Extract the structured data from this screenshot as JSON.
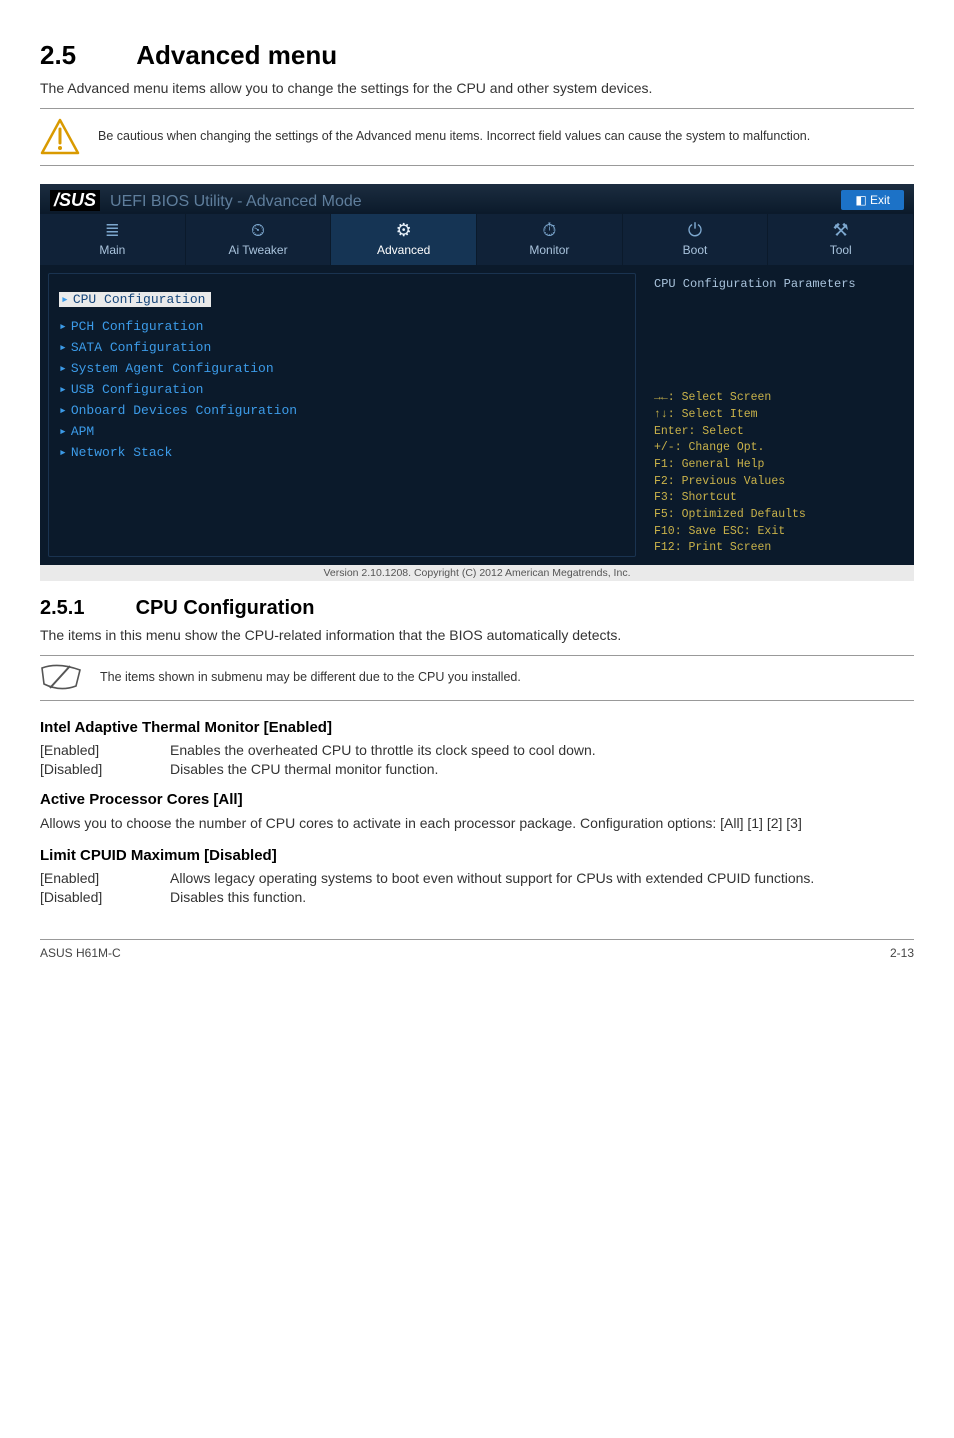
{
  "heading": {
    "num": "2.5",
    "title": "Advanced menu"
  },
  "intro": "The Advanced menu items allow you to change the settings for the CPU and other system devices.",
  "caution": "Be cautious when changing the settings of the Advanced menu items. Incorrect field values can cause the system to malfunction.",
  "bios": {
    "brand": "/SUS",
    "title_sub": "UEFI BIOS Utility - Advanced Mode",
    "exit_label": "Exit",
    "tabs": [
      {
        "icon": "≣",
        "label": "Main"
      },
      {
        "icon": "⏲",
        "label": "Ai Tweaker"
      },
      {
        "icon": "⚙",
        "label": "Advanced"
      },
      {
        "icon": "⏱",
        "label": "Monitor"
      },
      {
        "icon": "⏻",
        "label": "Boot"
      },
      {
        "icon": "⚒",
        "label": "Tool"
      }
    ],
    "active_tab": 2,
    "left_items": [
      "CPU Configuration",
      "PCH Configuration",
      "SATA Configuration",
      "System Agent Configuration",
      "USB Configuration",
      "Onboard Devices Configuration",
      "APM",
      "Network Stack"
    ],
    "right_title": "CPU Configuration Parameters",
    "key_help": [
      "→←: Select Screen",
      "↑↓: Select Item",
      "Enter: Select",
      "+/-: Change Opt.",
      "F1: General Help",
      "F2: Previous Values",
      "F3: Shortcut",
      "F5: Optimized Defaults",
      "F10: Save   ESC: Exit",
      "F12: Print Screen"
    ],
    "footer": "Version 2.10.1208. Copyright (C) 2012 American Megatrends, Inc."
  },
  "sub": {
    "num": "2.5.1",
    "title": "CPU Configuration"
  },
  "sub_intro": "The items in this menu show the CPU-related information that the BIOS automatically detects.",
  "note": "The items shown in submenu may be different due to the CPU you installed.",
  "adaptive": {
    "title": "Intel Adaptive Thermal Monitor [Enabled]",
    "rows": [
      {
        "k": "[Enabled]",
        "v": "Enables the overheated CPU to throttle its clock speed to cool down."
      },
      {
        "k": "[Disabled]",
        "v": "Disables the CPU thermal monitor function."
      }
    ]
  },
  "cores": {
    "title": "Active Processor Cores [All]",
    "body": "Allows you to choose the number of CPU cores to activate in each processor package. Configuration options: [All] [1] [2] [3]"
  },
  "cpuid": {
    "title": "Limit CPUID Maximum [Disabled]",
    "rows": [
      {
        "k": "[Enabled]",
        "v": "Allows legacy operating systems to boot even without support for CPUs with extended CPUID functions."
      },
      {
        "k": "[Disabled]",
        "v": "Disables this function."
      }
    ]
  },
  "footer": {
    "left": "ASUS H61M-C",
    "right": "2-13"
  }
}
